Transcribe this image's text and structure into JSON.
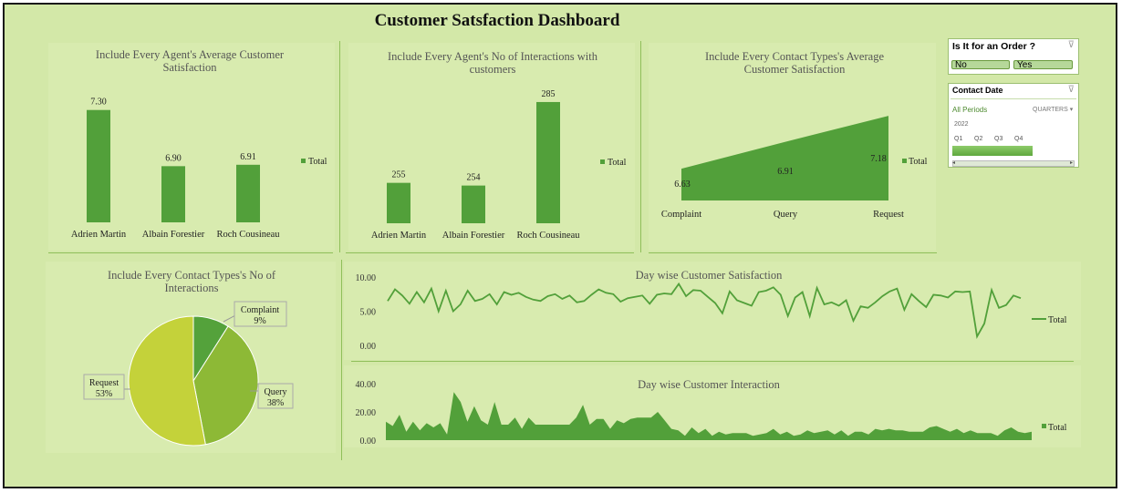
{
  "dashboard": {
    "title": "Customer Satsfaction Dashboard"
  },
  "colors": {
    "bar": "#52a03a",
    "background": "#d3e8a8",
    "pie_complaint": "#54a23b",
    "pie_query": "#8db936",
    "pie_request": "#c4d23a",
    "separator": "#8fbf5a"
  },
  "slicers": {
    "order": {
      "title": "Is It for an Order ?",
      "options": [
        "No",
        "Yes"
      ],
      "icon": "clear-filter-icon"
    },
    "date": {
      "title": "Contact Date",
      "all_periods": "All Periods",
      "level": "QUARTERS",
      "year": "2022",
      "quarters": [
        "Q1",
        "Q2",
        "Q3",
        "Q4"
      ],
      "icon": "clear-filter-icon"
    }
  },
  "chart_data": [
    {
      "id": "agent_satisfaction",
      "type": "bar",
      "title": "Include Every Agent's Average Customer Satisfaction",
      "categories": [
        "Adrien Martin",
        "Albain Forestier",
        "Roch Cousineau"
      ],
      "series": [
        {
          "name": "Total",
          "values": [
            7.3,
            6.9,
            6.91
          ]
        }
      ],
      "data_labels": [
        "7.30",
        "6.90",
        "6.91"
      ],
      "ylim": [
        6.5,
        7.35
      ],
      "legend": "right",
      "grid": false
    },
    {
      "id": "agent_interactions",
      "type": "bar",
      "title": "Include Every Agent's No of Interactions with customers",
      "categories": [
        "Adrien Martin",
        "Albain Forestier",
        "Roch Cousineau"
      ],
      "series": [
        {
          "name": "Total",
          "values": [
            255,
            254,
            285
          ]
        }
      ],
      "data_labels": [
        "255",
        "254",
        "285"
      ],
      "ylim": [
        240,
        286
      ],
      "legend": "right",
      "grid": false
    },
    {
      "id": "contact_satisfaction",
      "type": "area",
      "title": "Include Every Contact Types's Average Customer Satisfaction",
      "categories": [
        "Complaint",
        "Query",
        "Request"
      ],
      "series": [
        {
          "name": "Total",
          "values": [
            6.63,
            6.91,
            7.18
          ]
        }
      ],
      "data_labels": [
        "6.63",
        "6.91",
        "7.18"
      ],
      "ylim": [
        6.3,
        7.2
      ],
      "legend": "right",
      "grid": false
    },
    {
      "id": "contact_interactions",
      "type": "pie",
      "title": "Include Every Contact Types's No of Interactions",
      "labels": [
        "Complaint",
        "Query",
        "Request"
      ],
      "values": [
        9,
        38,
        53
      ],
      "percent_labels": [
        "9%",
        "38%",
        "53%"
      ]
    },
    {
      "id": "day_satisfaction",
      "type": "line",
      "title": "Day wise Customer Satisfaction",
      "yticks": [
        "10.00",
        "5.00",
        "0.00"
      ],
      "ylim": [
        0,
        10
      ],
      "series": [
        {
          "name": "Total",
          "values": [
            6.5,
            8.2,
            7.3,
            6.1,
            7.8,
            6.3,
            8.3,
            5.0,
            8.0,
            5.0,
            6.0,
            8.0,
            6.5,
            6.8,
            7.5,
            6.0,
            7.8,
            7.4,
            7.7,
            7.1,
            6.7,
            6.5,
            7.2,
            7.5,
            6.8,
            7.3,
            6.3,
            6.5,
            7.4,
            8.2,
            7.7,
            7.5,
            6.4,
            6.9,
            7.1,
            7.3,
            6.1,
            7.4,
            7.6,
            7.5,
            9.0,
            7.2,
            8.1,
            8.0,
            7.1,
            6.2,
            4.7,
            7.9,
            6.6,
            6.2,
            5.8,
            7.8,
            8.0,
            8.5,
            7.4,
            4.3,
            7.0,
            7.8,
            4.3,
            8.4,
            6.0,
            6.3,
            5.8,
            6.6,
            3.6,
            5.7,
            5.5,
            6.3,
            7.2,
            7.9,
            8.3,
            5.2,
            7.5,
            6.5,
            5.6,
            7.4,
            7.3,
            7.0,
            7.9,
            7.8,
            7.9,
            1.3,
            3.2,
            8.1,
            5.5,
            5.9,
            7.3,
            6.9
          ]
        }
      ],
      "legend": "right"
    },
    {
      "id": "day_interaction",
      "type": "area",
      "title": "Day wise Customer Interaction",
      "yticks": [
        "40.00",
        "20.00",
        "0.00"
      ],
      "ylim": [
        0,
        40
      ],
      "series": [
        {
          "name": "Total",
          "values": [
            13,
            10,
            18,
            6,
            13,
            7,
            12,
            9,
            12,
            4,
            34,
            27,
            13,
            24,
            14,
            11,
            27,
            11,
            11,
            16,
            8,
            16,
            11,
            11,
            11,
            11,
            11,
            11,
            16,
            25,
            11,
            15,
            15,
            8,
            14,
            12,
            15,
            16,
            16,
            16,
            20,
            14,
            8,
            7,
            3,
            9,
            5,
            8,
            3,
            6,
            4,
            5,
            5,
            5,
            3,
            4,
            5,
            8,
            4,
            6,
            3,
            4,
            7,
            5,
            6,
            7,
            4,
            7,
            3,
            6,
            6,
            4,
            8,
            7,
            8,
            7,
            7,
            6,
            6,
            6,
            9,
            10,
            8,
            6,
            8,
            5,
            7,
            5,
            5,
            5,
            3,
            7,
            9,
            6,
            5,
            6
          ]
        }
      ],
      "legend": "right"
    }
  ]
}
